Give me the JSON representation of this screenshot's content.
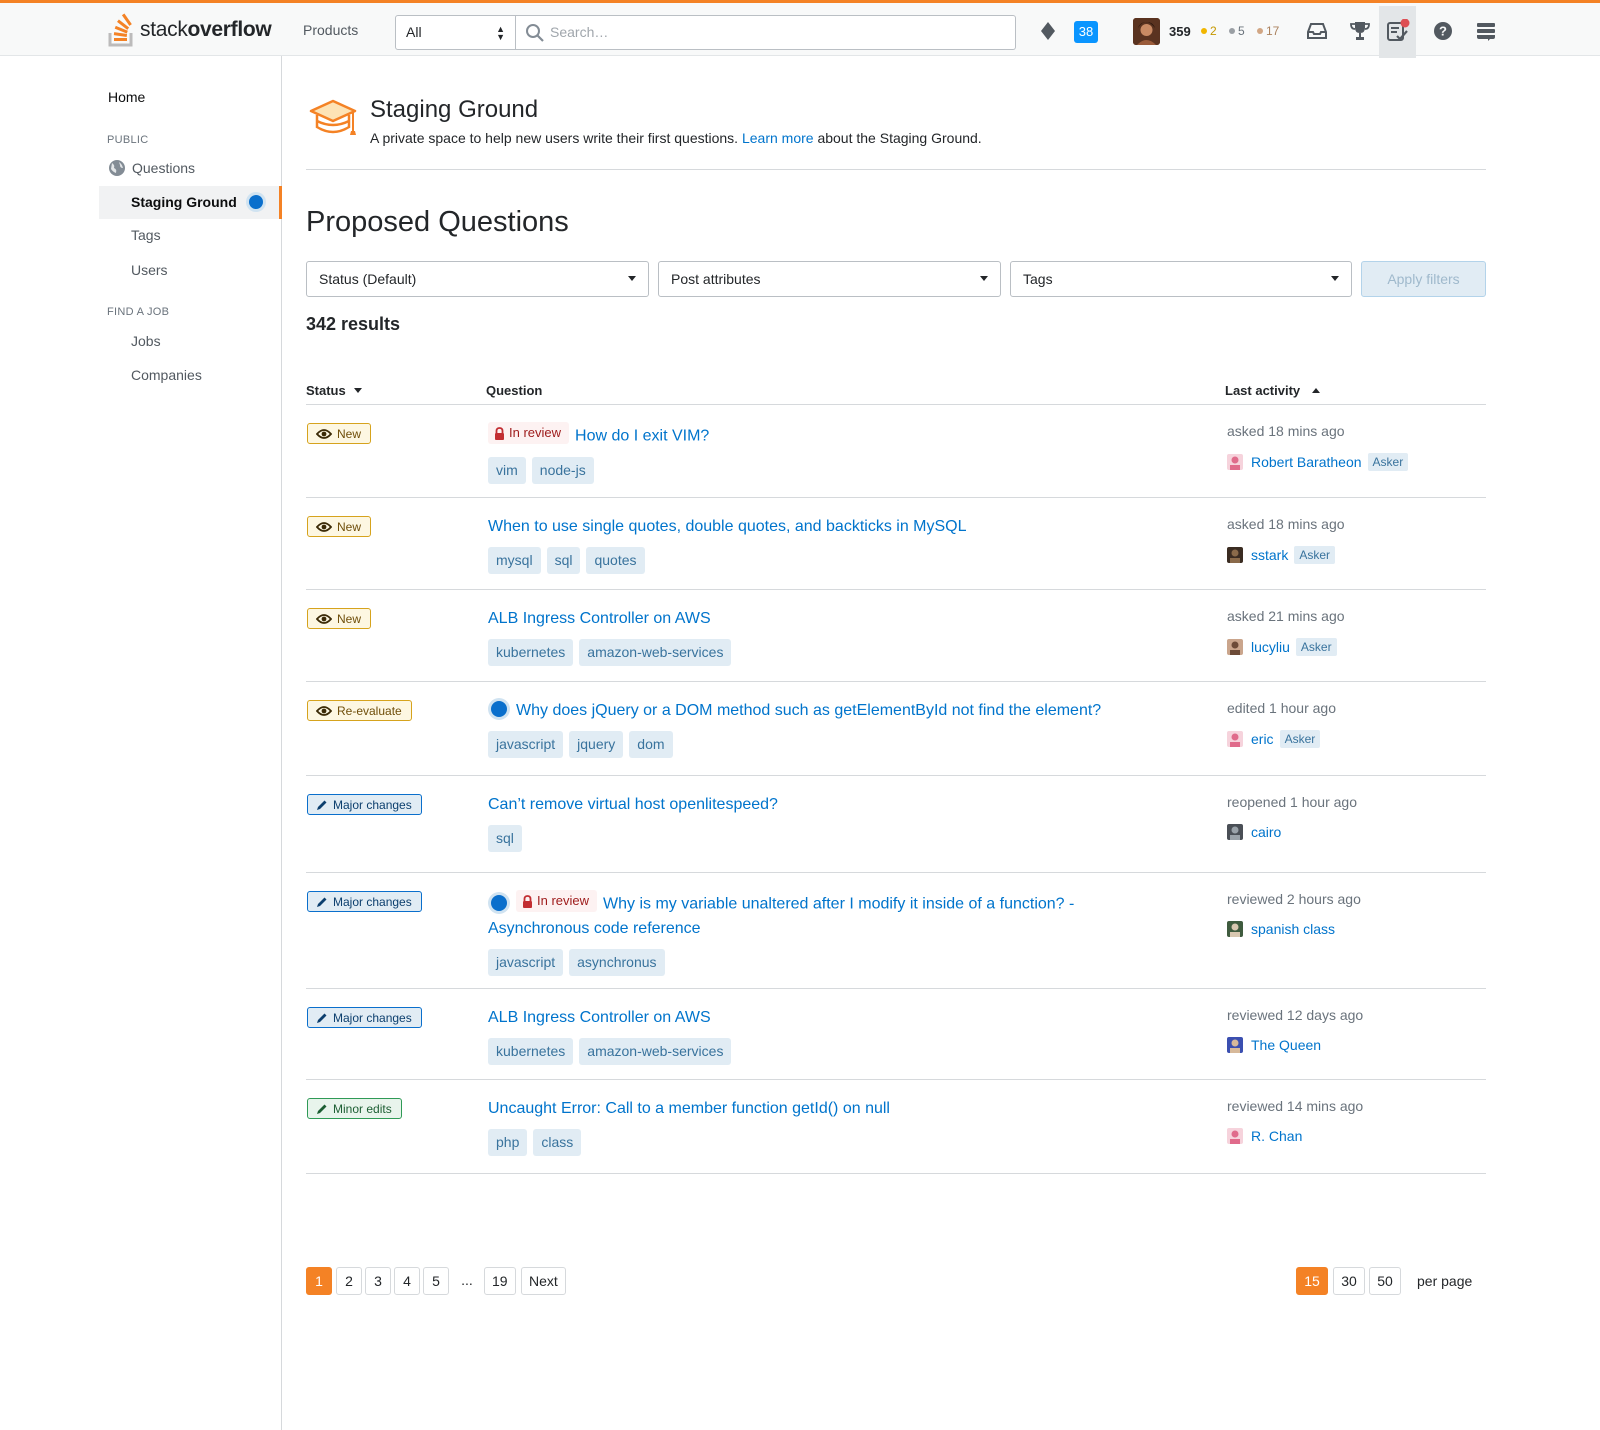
{
  "topbar": {
    "logo_light": "stack",
    "logo_bold": "overflow",
    "products": "Products",
    "scope": "All",
    "search_placeholder": "Search…",
    "review_count": "38",
    "reputation": "359",
    "gold": "2",
    "silver": "5",
    "bronze": "17",
    "colors": {
      "accent": "#f48225",
      "gold": "#f1b600",
      "silver": "#9a9fa4",
      "bronze": "#d1a684"
    }
  },
  "sidebar": {
    "home": "Home",
    "public_heading": "PUBLIC",
    "questions": "Questions",
    "staging_ground": "Staging Ground",
    "tags": "Tags",
    "users": "Users",
    "job_heading": "FIND A JOB",
    "jobs": "Jobs",
    "companies": "Companies"
  },
  "hero": {
    "title": "Staging Ground",
    "sub_before": "A private space to help new users write their first questions.",
    "learn_more": "Learn more",
    "sub_after": "about the Staging Ground."
  },
  "main": {
    "title": "Proposed Questions",
    "filters": [
      "Status (Default)",
      "Post attributes",
      "Tags"
    ],
    "apply": "Apply filters",
    "results": "342 results",
    "columns": {
      "status": "Status",
      "question": "Question",
      "activity": "Last activity"
    }
  },
  "rows": [
    {
      "status": "New",
      "kind": "new",
      "dot": false,
      "in_review": "In review",
      "title": "How do I exit VIM?",
      "title2": "",
      "tags": [
        "vim",
        "node-js"
      ],
      "activity": "asked 18 mins ago",
      "user": "Robert Baratheon",
      "asker": "Asker"
    },
    {
      "status": "New",
      "kind": "new",
      "dot": false,
      "in_review": "",
      "title": "When to use single quotes, double quotes, and backticks in MySQL",
      "title2": "",
      "tags": [
        "mysql",
        "sql",
        "quotes"
      ],
      "activity": "asked 18 mins ago",
      "user": "sstark",
      "asker": "Asker"
    },
    {
      "status": "New",
      "kind": "new",
      "dot": false,
      "in_review": "",
      "title": "ALB Ingress Controller on AWS",
      "title2": "",
      "tags": [
        "kubernetes",
        "amazon-web-services"
      ],
      "activity": "asked 21 mins ago",
      "user": "lucyliu",
      "asker": "Asker"
    },
    {
      "status": "Re-evaluate",
      "kind": "new",
      "dot": true,
      "in_review": "",
      "title": "Why does jQuery or a DOM method such as getElementById not find the element?",
      "title2": "",
      "tags": [
        "javascript",
        "jquery",
        "dom"
      ],
      "activity": "edited 1 hour ago",
      "user": "eric",
      "asker": "Asker"
    },
    {
      "status": "Major changes",
      "kind": "major",
      "dot": false,
      "in_review": "",
      "title": "Can’t remove virtual host openlitespeed?",
      "title2": "",
      "tags": [
        "sql"
      ],
      "activity": "reopened 1 hour ago",
      "user": "cairo",
      "asker": ""
    },
    {
      "status": "Major changes",
      "kind": "major",
      "dot": true,
      "in_review": "In review",
      "title": "Why is my variable unaltered after I modify it inside of a function? -",
      "title2": "Asynchronous code reference",
      "tags": [
        "javascript",
        "asynchronus"
      ],
      "activity": "reviewed 2 hours ago",
      "user": "spanish class",
      "asker": ""
    },
    {
      "status": "Major changes",
      "kind": "major",
      "dot": false,
      "in_review": "",
      "title": "ALB Ingress Controller on AWS",
      "title2": "",
      "tags": [
        "kubernetes",
        "amazon-web-services"
      ],
      "activity": "reviewed 12 days ago",
      "user": "The Queen",
      "asker": ""
    },
    {
      "status": "Minor edits",
      "kind": "minor",
      "dot": false,
      "in_review": "",
      "title": "Uncaught Error: Call to a member function getId() on null",
      "title2": "",
      "tags": [
        "php",
        "class"
      ],
      "activity": "reviewed 14 mins ago",
      "user": "R. Chan",
      "asker": ""
    }
  ],
  "pagination": {
    "pages": [
      "1",
      "2",
      "3",
      "4",
      "5",
      "...",
      "19",
      "Next"
    ],
    "current": "1",
    "per_page_options": [
      "15",
      "30",
      "50"
    ],
    "per_page_current": "15",
    "per_page_label": "per page"
  }
}
